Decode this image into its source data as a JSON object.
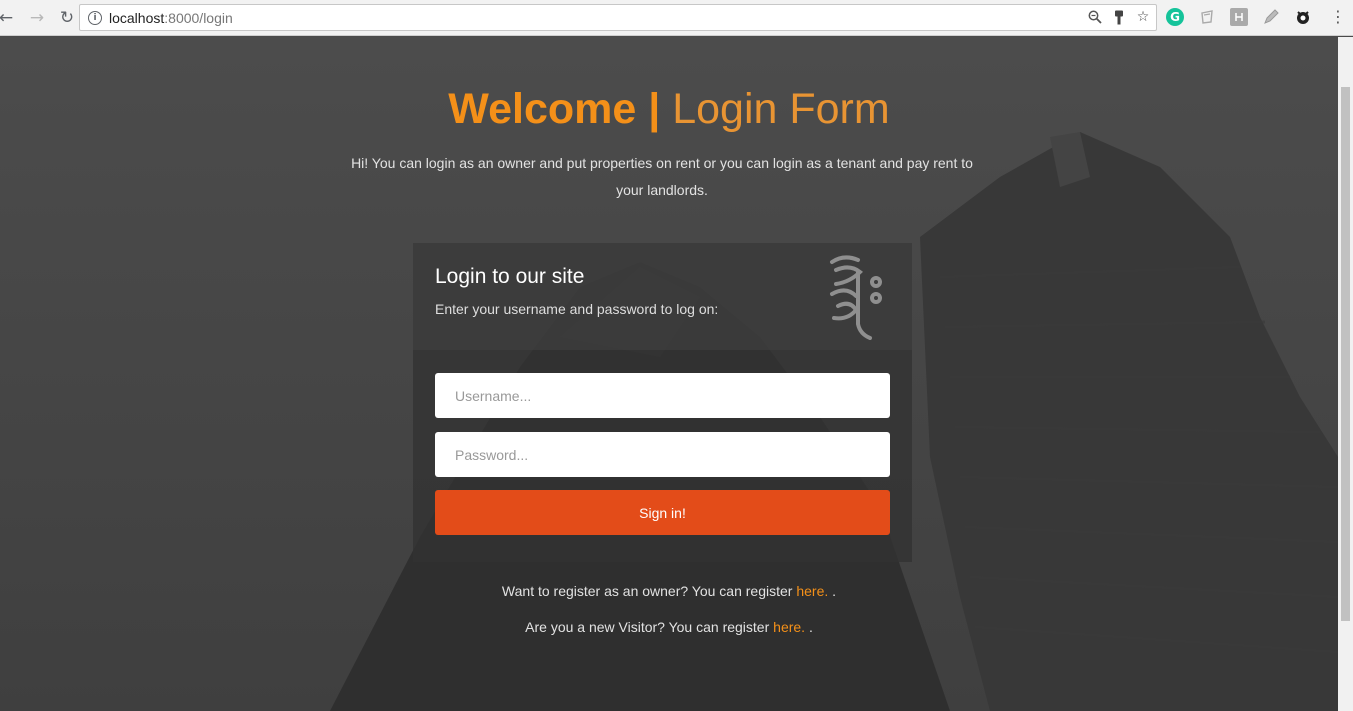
{
  "browser": {
    "url_host": "localhost",
    "url_path": ":8000/login",
    "info_icon_glyph": "i",
    "icons": [
      "back-icon",
      "forward-icon",
      "reload-icon",
      "zoom-icon",
      "key-icon",
      "star-icon",
      "grammarly-icon",
      "extension-icon",
      "extension-icon",
      "pen-icon",
      "extension-icon",
      "menu-icon"
    ]
  },
  "page": {
    "title_bold": "Welcome |",
    "title_light": "Login Form",
    "subtitle": "Hi! You can login as an owner and put properties on rent or you can login as a tenant and pay rent to your landlords."
  },
  "form": {
    "heading": "Login to our site",
    "description": "Enter your username and password to log on:",
    "username_placeholder": "Username...",
    "password_placeholder": "Password...",
    "submit_label": "Sign in!"
  },
  "register": {
    "owner_text": "Want to register as an owner? You can register",
    "owner_link": "here.",
    "owner_tail": ".",
    "visitor_text": "Are you a new Visitor? You can register",
    "visitor_link": "here.",
    "visitor_tail": "."
  },
  "colors": {
    "accent": "#f49019",
    "button": "#e34c19"
  }
}
